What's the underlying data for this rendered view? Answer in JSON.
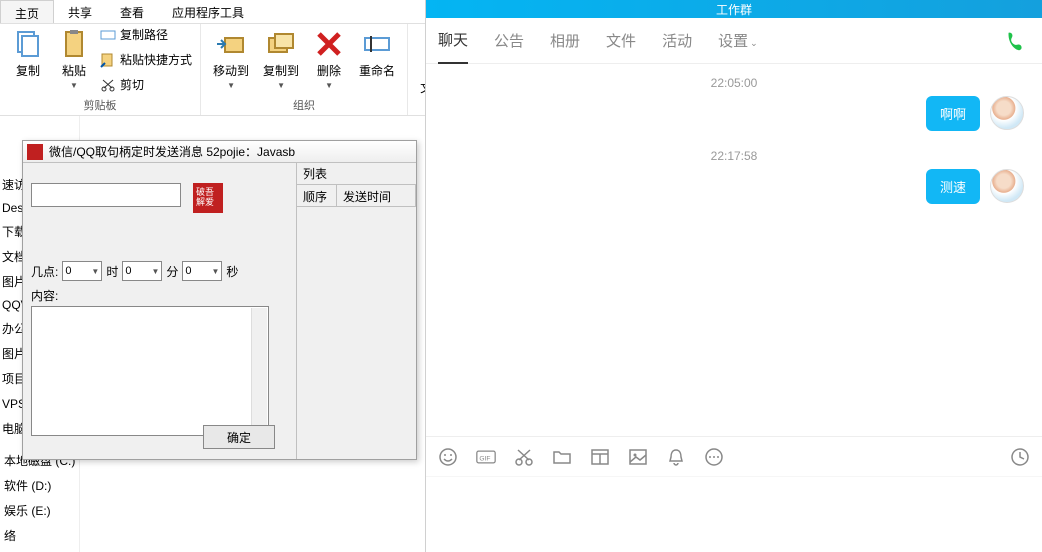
{
  "ribbon": {
    "tabs": [
      "主页",
      "共享",
      "查看",
      "应用程序工具"
    ],
    "active_tab": 0,
    "copy": "复制",
    "paste": "粘贴",
    "copy_path": "复制路径",
    "paste_shortcut": "粘贴快捷方式",
    "cut": "剪切",
    "group_clipboard": "剪贴板",
    "move_to": "移动到",
    "copy_to": "复制到",
    "delete": "删除",
    "rename": "重命名",
    "new_folder": "新建\n文件夹",
    "group_organize": "组织"
  },
  "sidebar": {
    "items": [
      "速访",
      "Desk",
      "下载",
      "文档",
      "图片",
      "QQV",
      "办公",
      "图片",
      "项目",
      "VPS网",
      "电脑"
    ]
  },
  "drives": [
    "本地磁盘 (C:)",
    "软件 (D:)",
    "娱乐 (E:)",
    "络"
  ],
  "dialog": {
    "title": "微信/QQ取句柄定时发送消息 52pojie：Javasb",
    "logo_text": "破吾解爱",
    "time_label": "几点:",
    "hour_value": "0",
    "hour_unit": "时",
    "minute_value": "0",
    "minute_unit": "分",
    "second_value": "0",
    "second_unit": "秒",
    "content_label": "内容:",
    "confirm": "确定",
    "list_title": "列表",
    "col_order": "顺序",
    "col_time": "发送时间"
  },
  "chat": {
    "banner": "工作群",
    "tabs": [
      {
        "label": "聊天",
        "active": true
      },
      {
        "label": "公告"
      },
      {
        "label": "相册"
      },
      {
        "label": "文件"
      },
      {
        "label": "活动"
      },
      {
        "label": "设置",
        "dropdown": true
      }
    ],
    "messages": [
      {
        "time": "22:05:00",
        "text": "啊啊"
      },
      {
        "time": "22:17:58",
        "text": "测速"
      }
    ],
    "toolbar_icons": [
      "emoji-icon",
      "gif-icon",
      "scissors-icon",
      "folder-icon",
      "window-icon",
      "image-icon",
      "bell-icon",
      "more-icon"
    ],
    "clock_icon": "history-icon"
  }
}
